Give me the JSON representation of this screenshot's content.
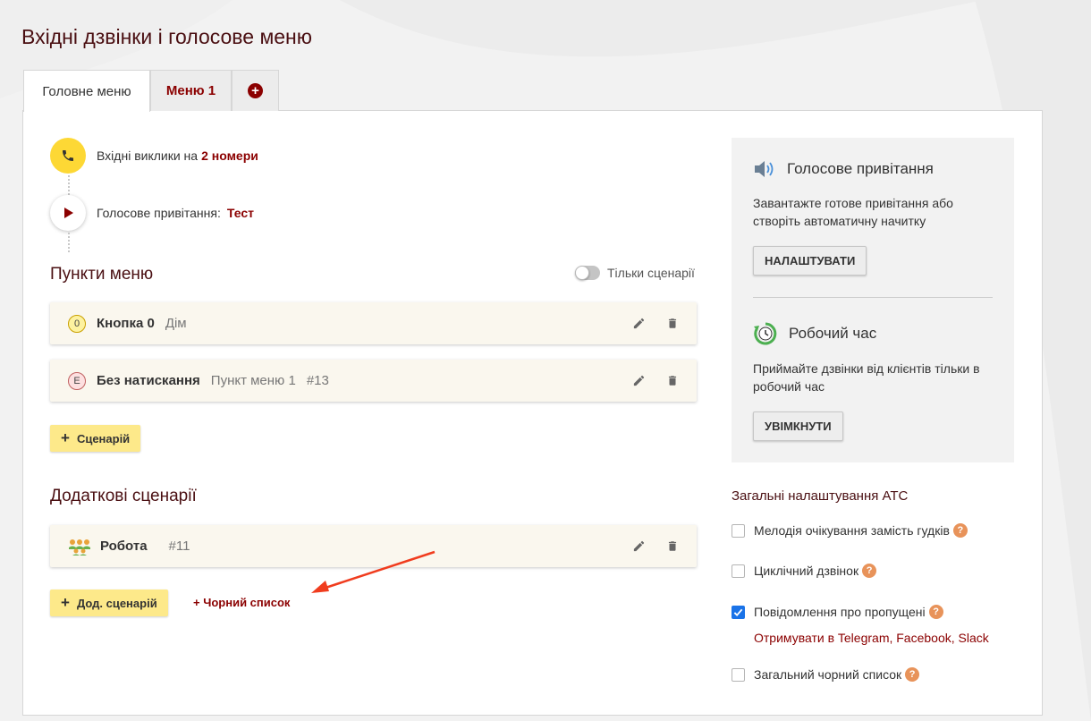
{
  "page": {
    "title": "Вхідні дзвінки і голосове меню"
  },
  "tabs": [
    {
      "label": "Головне меню"
    },
    {
      "label": "Меню 1"
    },
    {
      "label": "+"
    }
  ],
  "flow": {
    "incoming_text": "Вхідні виклики на",
    "incoming_value": "2 номери",
    "greeting_text": "Голосове привітання:",
    "greeting_value": "Тест"
  },
  "menu_items": {
    "title": "Пункти меню",
    "toggle_label": "Тільки сценарії",
    "rows": [
      {
        "badge": "0",
        "name": "Кнопка 0",
        "target": "Дім",
        "id": ""
      },
      {
        "badge": "E",
        "name": "Без натискання",
        "target": "Пункт меню 1",
        "id": "#13"
      }
    ],
    "add_button": "Сценарій"
  },
  "extra_scenarios": {
    "title": "Додаткові сценарії",
    "rows": [
      {
        "name": "Робота",
        "id": "#11"
      }
    ],
    "add_button": "Дод. сценарій",
    "blacklist_link": "+ Чорний список"
  },
  "side": {
    "greeting": {
      "title": "Голосове привітання",
      "text": "Завантажте готове привітання або створіть автоматичну начитку",
      "button": "НАЛАШТУВАТИ"
    },
    "work_time": {
      "title": "Робочий час",
      "text": "Приймайте дзвінки від клієнтів тільки в робочий час",
      "button": "УВІМКНУТИ"
    }
  },
  "settings": {
    "title": "Загальні налаштування АТС",
    "options": [
      {
        "label": "Мелодія очікування замість гудків",
        "checked": false
      },
      {
        "label": "Циклічний дзвінок",
        "checked": false
      },
      {
        "label": "Повідомлення про пропущені",
        "checked": true
      },
      {
        "label": "Загальний чорний список",
        "checked": false
      }
    ],
    "missed_link": "Отримувати в Telegram, Facebook, Slack"
  },
  "colors": {
    "accent": "#8b0000",
    "yellow": "#fdd835",
    "button_yellow": "#fde98a",
    "check_blue": "#1a73e8"
  }
}
